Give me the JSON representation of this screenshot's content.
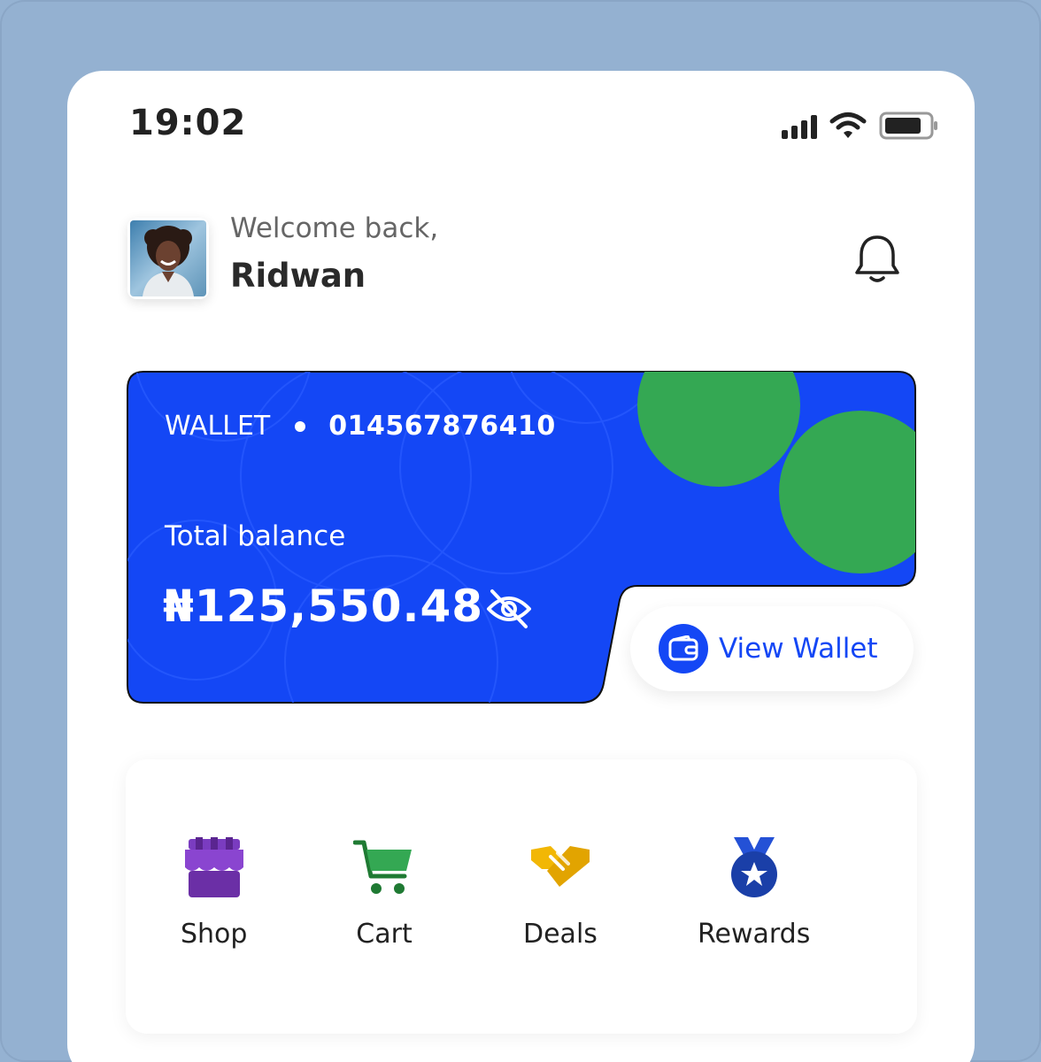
{
  "status_bar": {
    "time": "19:02"
  },
  "header": {
    "greeting": "Welcome back,",
    "name": "Ridwan"
  },
  "wallet_card": {
    "label": "WALLET",
    "account_number": "014567876410",
    "balance_label": "Total balance",
    "balance": "₦125,550.48",
    "button_label": "View Wallet",
    "colors": {
      "card": "#1447f5",
      "accent": "#34a853"
    }
  },
  "quick_actions": [
    {
      "label": "Shop",
      "icon": "shop-icon",
      "color": "#6b2fa6"
    },
    {
      "label": "Cart",
      "icon": "cart-icon",
      "color": "#2e8b3a"
    },
    {
      "label": "Deals",
      "icon": "handshake-icon",
      "color": "#e2a400"
    },
    {
      "label": "Rewards",
      "icon": "medal-icon",
      "color": "#1a3fa8"
    }
  ]
}
